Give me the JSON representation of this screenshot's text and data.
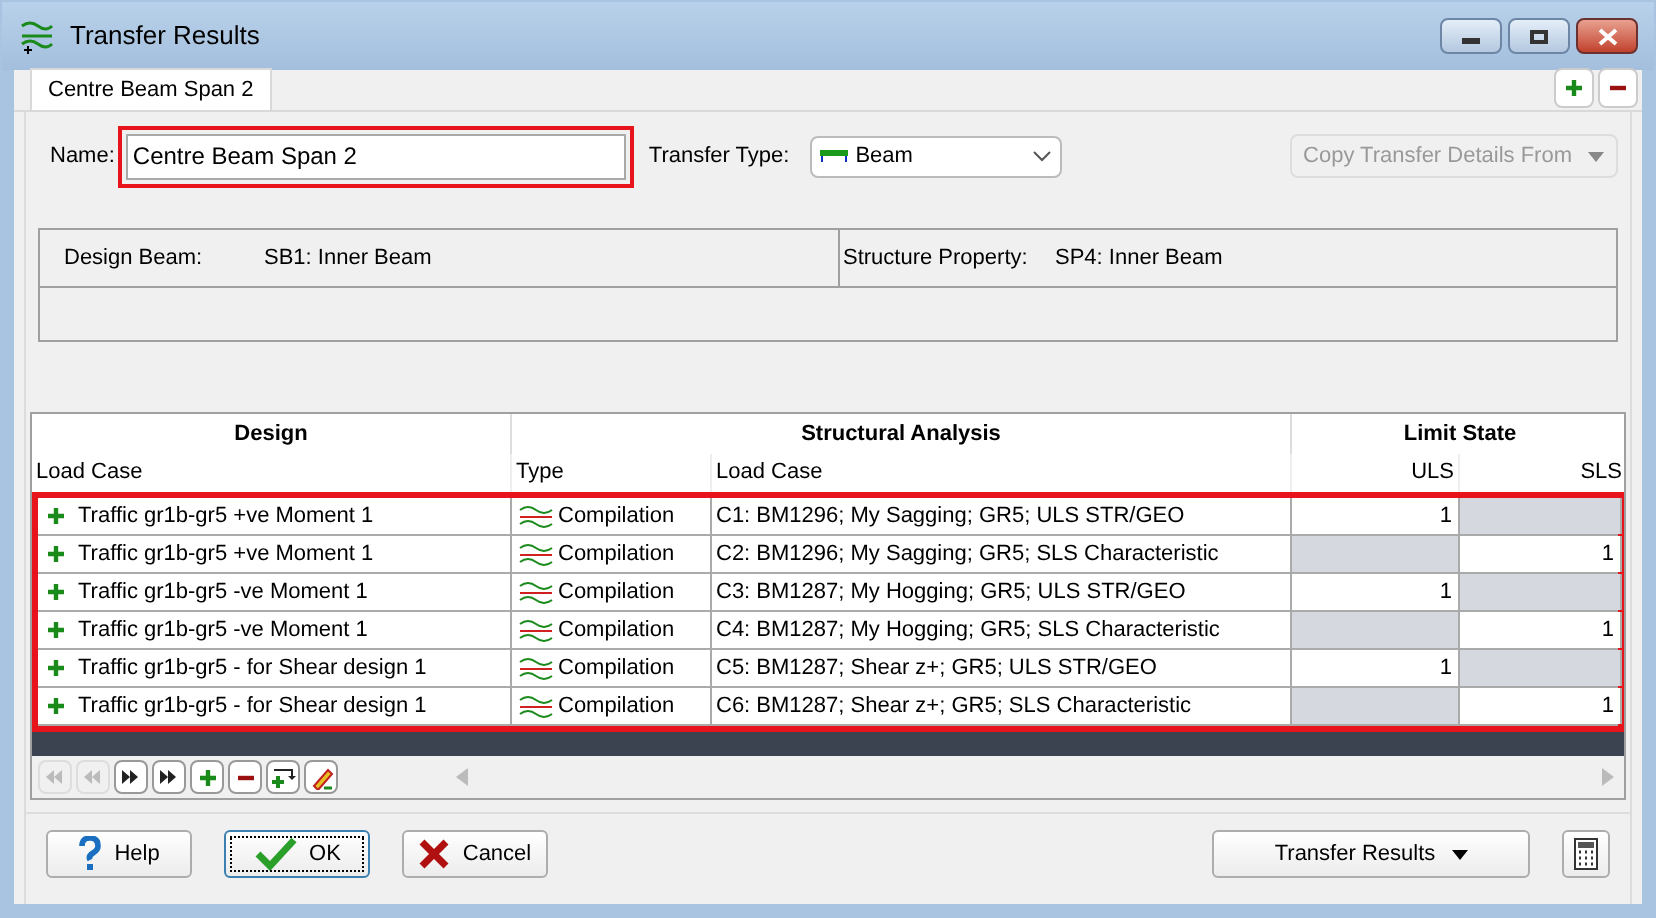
{
  "window": {
    "title": "Transfer Results"
  },
  "tabs": [
    {
      "label": "Centre Beam Span 2",
      "selected": true
    }
  ],
  "name_field": {
    "label": "Name:",
    "value": "Centre Beam Span 2",
    "highlighted": true
  },
  "transfer_type": {
    "label": "Transfer Type:",
    "value": "Beam"
  },
  "copy_button": {
    "label": "Copy Transfer Details From",
    "disabled": true
  },
  "info": [
    {
      "label": "Design Beam:",
      "value": "SB1: Inner Beam"
    },
    {
      "label": "Structure Property:",
      "value": "SP4: Inner Beam"
    }
  ],
  "table": {
    "groups": [
      "Design",
      "Structural Analysis",
      "Limit State"
    ],
    "columns": [
      "Load Case",
      "Type",
      "Load Case",
      "ULS",
      "SLS"
    ],
    "highlighted": true,
    "rows": [
      {
        "design": "Traffic gr1b-gr5 +ve Moment 1",
        "type": "Compilation",
        "load_case": "C1: BM1296; My Sagging; GR5; ULS STR/GEO",
        "uls": {
          "value": "1",
          "enabled": true
        },
        "sls": {
          "enabled": false
        }
      },
      {
        "design": "Traffic gr1b-gr5 +ve Moment 1",
        "type": "Compilation",
        "load_case": "C2: BM1296; My Sagging; GR5; SLS Characteristic",
        "uls": {
          "enabled": false
        },
        "sls": {
          "value": "1",
          "enabled": true
        }
      },
      {
        "design": "Traffic gr1b-gr5 -ve Moment 1",
        "type": "Compilation",
        "load_case": "C3: BM1287; My Hogging; GR5; ULS STR/GEO",
        "uls": {
          "value": "1",
          "enabled": true
        },
        "sls": {
          "enabled": false
        }
      },
      {
        "design": "Traffic gr1b-gr5 -ve Moment 1",
        "type": "Compilation",
        "load_case": "C4: BM1287; My Hogging; GR5; SLS Characteristic",
        "uls": {
          "enabled": false
        },
        "sls": {
          "value": "1",
          "enabled": true
        }
      },
      {
        "design": "Traffic gr1b-gr5 - for Shear design 1",
        "type": "Compilation",
        "load_case": "C5: BM1287; Shear z+; GR5; ULS STR/GEO",
        "uls": {
          "value": "1",
          "enabled": true
        },
        "sls": {
          "enabled": false
        }
      },
      {
        "design": "Traffic gr1b-gr5 - for Shear design 1",
        "type": "Compilation",
        "load_case": "C6: BM1287; Shear z+; GR5; SLS Characteristic",
        "uls": {
          "enabled": false
        },
        "sls": {
          "value": "1",
          "enabled": true
        }
      }
    ]
  },
  "buttons": [
    {
      "label": "Help",
      "kind": "help"
    },
    {
      "label": "OK",
      "kind": "ok"
    },
    {
      "label": "Cancel",
      "kind": "cancel"
    }
  ],
  "transfer_button": {
    "label": "Transfer Results"
  }
}
